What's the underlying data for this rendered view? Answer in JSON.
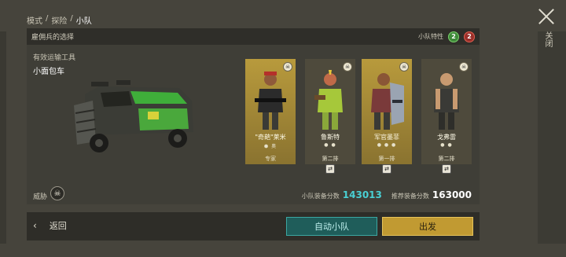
{
  "breadcrumb": {
    "items": [
      "模式",
      "探险"
    ],
    "current": "小队",
    "separator": "/"
  },
  "close": {
    "label": "关闭"
  },
  "panel": {
    "title": "雇佣兵的选择",
    "squad_traits_label": "小队特性",
    "traits": [
      {
        "kind": "green",
        "value": "2",
        "color": "#3f8a3a"
      },
      {
        "kind": "red",
        "value": "2",
        "color": "#9a2f2a"
      }
    ],
    "vehicle_label": "有效运输工具",
    "vehicle_name": "小面包车",
    "threat_label": "威胁",
    "threat_icon": "skull-icon",
    "squad_score_label": "小队装备分数",
    "squad_score": "143013",
    "recommended_label": "推荐装备分数",
    "recommended_score": "163000"
  },
  "mercenaries": [
    {
      "name": "\"奇葩\"莱米",
      "dots": "⬢ 奥",
      "role": "专家",
      "style": "gold",
      "shirt": "#2b2b2b",
      "skin": "#8f5a3a",
      "extra": "#b5302a",
      "top_icon": "skull-icon"
    },
    {
      "name": "鲁斯特",
      "dots": "● ●",
      "role": "第二排",
      "style": "dark",
      "shirt": "#a6c83a",
      "skin": "#c06a48",
      "extra": "#e8c83a",
      "top_icon": "skull-icon"
    },
    {
      "name": "军官墨菲",
      "dots": "● ● ●",
      "role": "第一排",
      "style": "gold",
      "shirt": "#7a3a3a",
      "skin": "#8a5636",
      "extra": "#9aa4b2",
      "top_icon": "skull-icon"
    },
    {
      "name": "戈弗雷",
      "dots": "● ●",
      "role": "第二排",
      "style": "dark",
      "shirt": "#3a3a36",
      "skin": "#c89a70",
      "extra": "#2e2e2a",
      "top_icon": "skull-icon"
    }
  ],
  "bottom": {
    "back_label": "返回",
    "auto_squad_label": "自动小队",
    "depart_label": "出发"
  },
  "colors": {
    "cyan": "#49d0d4",
    "gold": "#c19a32",
    "teal": "#1f5d5a"
  }
}
